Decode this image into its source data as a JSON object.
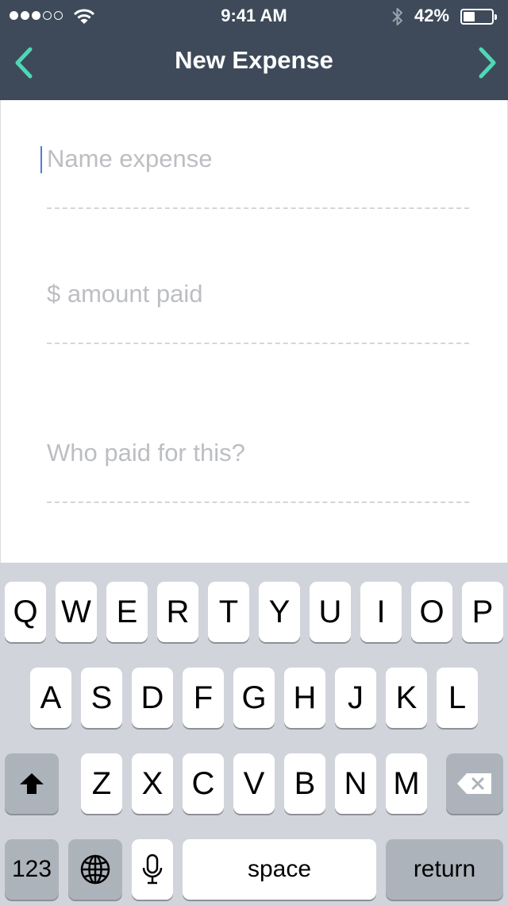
{
  "status_bar": {
    "time": "9:41 AM",
    "battery_percent": "42%",
    "battery_level": 0.42,
    "signal_bars_filled": 3,
    "signal_bars_total": 5,
    "icons": [
      "signal-dots-icon",
      "wifi-icon",
      "bluetooth-icon",
      "battery-icon"
    ]
  },
  "nav": {
    "title": "New Expense",
    "back_icon": "chevron-left-icon",
    "next_icon": "chevron-right-icon",
    "accent_color": "#4ed8b4",
    "bar_color": "#3e4a59"
  },
  "form": {
    "name_placeholder": "Name expense",
    "amount_placeholder": "$ amount paid",
    "payer_placeholder": "Who paid for this?"
  },
  "keyboard": {
    "row1": [
      "Q",
      "W",
      "E",
      "R",
      "T",
      "Y",
      "U",
      "I",
      "O",
      "P"
    ],
    "row2": [
      "A",
      "S",
      "D",
      "F",
      "G",
      "H",
      "J",
      "K",
      "L"
    ],
    "row3": [
      "Z",
      "X",
      "C",
      "V",
      "B",
      "N",
      "M"
    ],
    "numbers_label": "123",
    "space_label": "space",
    "return_label": "return",
    "icons": [
      "shift-icon",
      "delete-icon",
      "globe-icon",
      "microphone-icon"
    ]
  }
}
